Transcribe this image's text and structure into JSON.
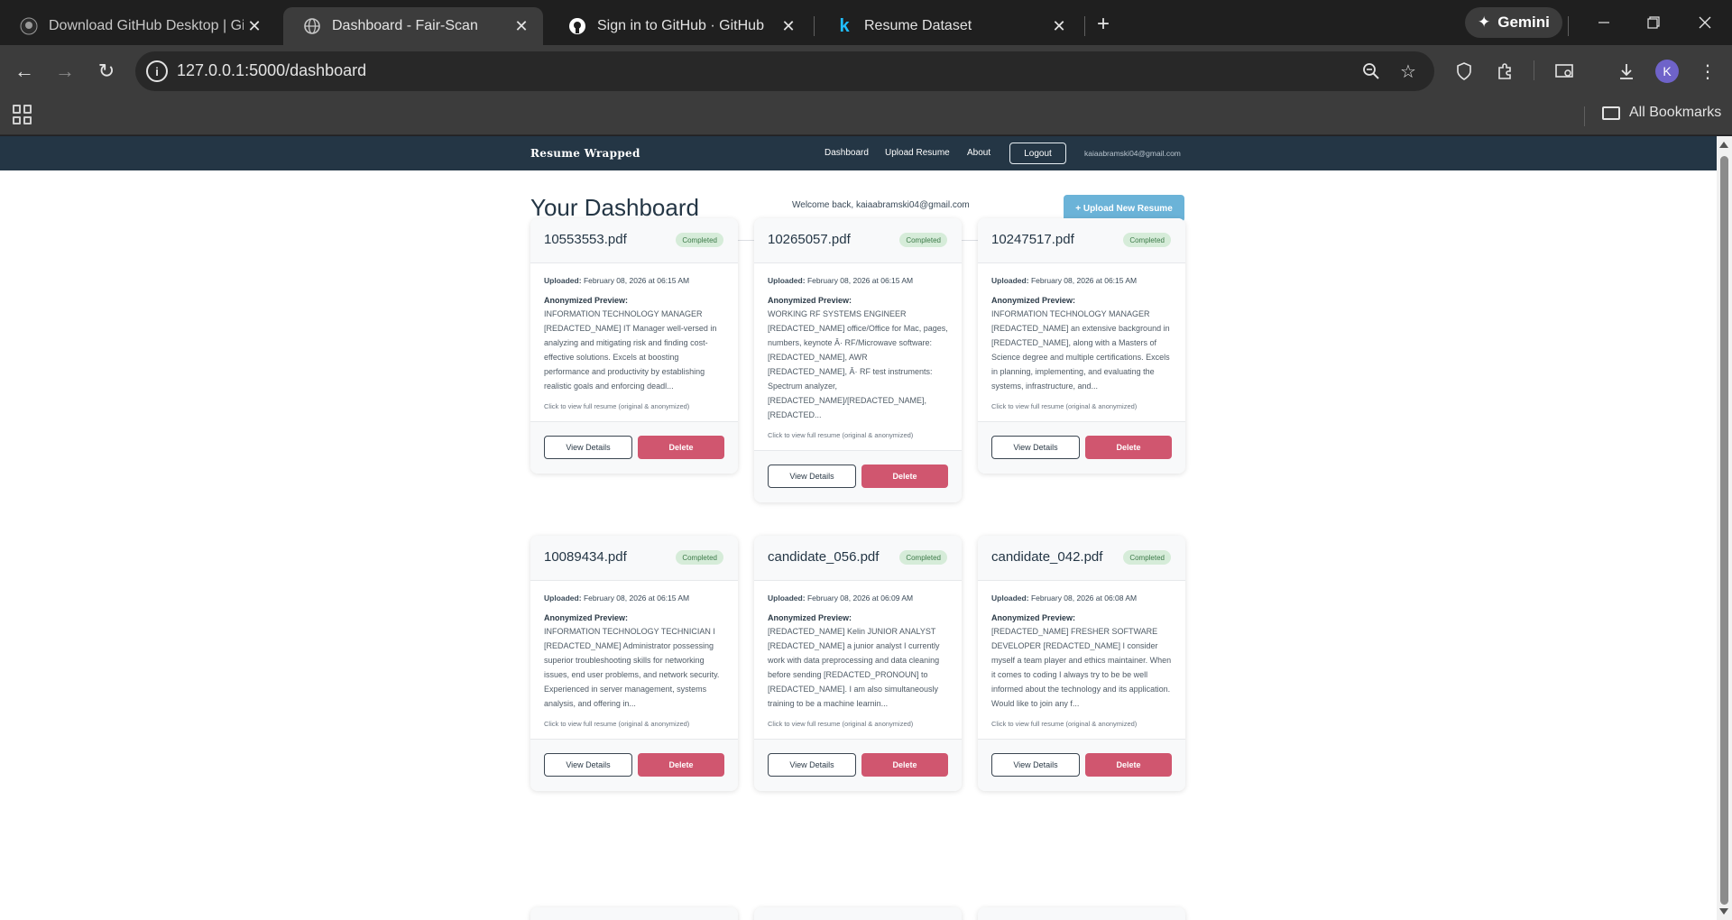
{
  "browser": {
    "tabs": [
      {
        "title": "Download GitHub Desktop | GitHub",
        "icon": "github-icon",
        "active": false
      },
      {
        "title": "Dashboard - Fair-Scan",
        "icon": "globe-icon",
        "active": true
      },
      {
        "title": "Sign in to GitHub · GitHub",
        "icon": "github-icon",
        "active": false
      },
      {
        "title": "Resume Dataset",
        "icon": "kaggle-icon",
        "active": false
      }
    ],
    "gemini_label": "Gemini",
    "url": "127.0.0.1:5000/dashboard",
    "avatar_letter": "K",
    "bookmarks_label": "All Bookmarks"
  },
  "site_nav": {
    "brand": "Resume Wrapped",
    "links": [
      "Dashboard",
      "Upload Resume",
      "About"
    ],
    "logout": "Logout",
    "email": "kaiaabramski04@gmail.com"
  },
  "dashboard": {
    "title": "Your Dashboard",
    "welcome": "Welcome back, kaiaabramski04@gmail.com",
    "upload_button": "+ Upload New Resume",
    "uploaded_label": "Uploaded:",
    "preview_label": "Anonymized Preview:",
    "click_hint": "Click to view full resume (original & anonymized)",
    "view_label": "View Details",
    "delete_label": "Delete"
  },
  "cards": [
    {
      "name": "10553553.pdf",
      "status": "Completed",
      "uploaded": "February 08, 2026 at 06:15 AM",
      "preview": "INFORMATION TECHNOLOGY MANAGER [REDACTED_NAME] IT Manager well-versed in analyzing and mitigating risk and finding cost-effective solutions. Excels at boosting performance and productivity by establishing realistic goals and enforcing deadl..."
    },
    {
      "name": "10265057.pdf",
      "status": "Completed",
      "uploaded": "February 08, 2026 at 06:15 AM",
      "preview": "WORKING RF SYSTEMS ENGINEER [REDACTED_NAME] office/Office for Mac, pages, numbers, keynote Â· RF/Microwave software: [REDACTED_NAME], AWR [REDACTED_NAME], Â· RF test instruments: Spectrum analyzer, [REDACTED_NAME]/[REDACTED_NAME], [REDACTED..."
    },
    {
      "name": "10247517.pdf",
      "status": "Completed",
      "uploaded": "February 08, 2026 at 06:15 AM",
      "preview": "INFORMATION TECHNOLOGY MANAGER [REDACTED_NAME] an extensive background in [REDACTED_NAME], along with a Masters of Science degree and multiple certifications. Excels in planning, implementing, and evaluating the systems, infrastructure, and..."
    },
    {
      "name": "10089434.pdf",
      "status": "Completed",
      "uploaded": "February 08, 2026 at 06:15 AM",
      "preview": "INFORMATION TECHNOLOGY TECHNICIAN I [REDACTED_NAME] Administrator possessing superior troubleshooting skills for networking issues, end user problems, and network security. Experienced in server management, systems analysis, and offering in..."
    },
    {
      "name": "candidate_056.pdf",
      "status": "Completed",
      "uploaded": "February 08, 2026 at 06:09 AM",
      "preview": "[REDACTED_NAME] Kelin JUNIOR ANALYST [REDACTED_NAME] a junior analyst I currently work with data preprocessing and data cleaning before sending [REDACTED_PRONOUN] to [REDACTED_NAME]. I am also simultaneously training to be a machine learnin..."
    },
    {
      "name": "candidate_042.pdf",
      "status": "Completed",
      "uploaded": "February 08, 2026 at 06:08 AM",
      "preview": "[REDACTED_NAME] FRESHER SOFTWARE DEVELOPER [REDACTED_NAME] I consider myself a team player and ethics maintainer. When it comes to coding I always try to be be well informed about the technology and its application. Would like to join any f..."
    }
  ]
}
